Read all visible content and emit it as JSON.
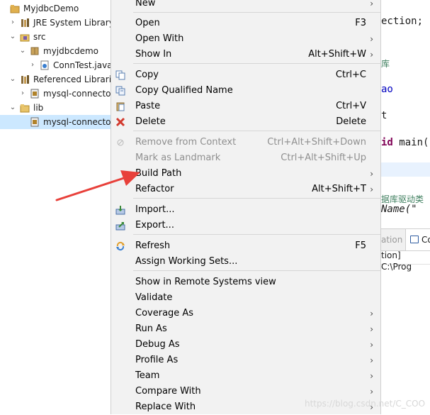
{
  "tree": {
    "items": [
      {
        "label": "MyjdbcDemo",
        "icon": "project-icon",
        "chevron": "",
        "selected": false
      },
      {
        "label": "JRE System Library [J",
        "icon": "library-icon",
        "chevron": "›",
        "selected": false
      },
      {
        "label": "src",
        "icon": "source-folder-icon",
        "chevron": "⌄",
        "selected": false
      },
      {
        "label": "myjdbcdemo",
        "icon": "package-icon",
        "chevron": "⌄",
        "selected": false
      },
      {
        "label": "ConnTest.java",
        "icon": "java-file-icon",
        "chevron": "›",
        "selected": false
      },
      {
        "label": "Referenced Libraries",
        "icon": "library-icon",
        "chevron": "⌄",
        "selected": false
      },
      {
        "label": "mysql-connector-",
        "icon": "jar-icon",
        "chevron": "›",
        "selected": false
      },
      {
        "label": "lib",
        "icon": "folder-icon",
        "chevron": "⌄",
        "selected": false
      },
      {
        "label": "mysql-connector-",
        "icon": "jar-icon",
        "chevron": "",
        "selected": true
      }
    ]
  },
  "editor": {
    "line1": "ection;",
    "line2_cmt": "库",
    "line3": "ao",
    "line4": "t",
    "line5_kw": "id",
    "line5_rest": " main(",
    "line6_cmt": "据库驱动类",
    "line7": "Name(\"",
    "tab_partial": "ation",
    "tab_console": "Co",
    "console_text": "tion] C:\\Prog"
  },
  "menu": {
    "items": [
      {
        "label": "New",
        "shortcut": "",
        "submenu": true,
        "disabled": false,
        "icon": ""
      },
      {
        "sep": true
      },
      {
        "label": "Open",
        "shortcut": "F3",
        "submenu": false,
        "disabled": false,
        "icon": ""
      },
      {
        "label": "Open With",
        "shortcut": "",
        "submenu": true,
        "disabled": false,
        "icon": ""
      },
      {
        "label": "Show In",
        "shortcut": "Alt+Shift+W",
        "submenu": true,
        "disabled": false,
        "icon": ""
      },
      {
        "sep": true
      },
      {
        "label": "Copy",
        "shortcut": "Ctrl+C",
        "submenu": false,
        "disabled": false,
        "icon": "copy-icon"
      },
      {
        "label": "Copy Qualified Name",
        "shortcut": "",
        "submenu": false,
        "disabled": false,
        "icon": "copy-qualified-icon"
      },
      {
        "label": "Paste",
        "shortcut": "Ctrl+V",
        "submenu": false,
        "disabled": false,
        "icon": "paste-icon"
      },
      {
        "label": "Delete",
        "shortcut": "Delete",
        "submenu": false,
        "disabled": false,
        "icon": "delete-icon"
      },
      {
        "sep": true
      },
      {
        "label": "Remove from Context",
        "shortcut": "Ctrl+Alt+Shift+Down",
        "submenu": false,
        "disabled": true,
        "icon": "remove-context-icon"
      },
      {
        "label": "Mark as Landmark",
        "shortcut": "Ctrl+Alt+Shift+Up",
        "submenu": false,
        "disabled": true,
        "icon": ""
      },
      {
        "label": "Build Path",
        "shortcut": "",
        "submenu": true,
        "disabled": false,
        "icon": ""
      },
      {
        "label": "Refactor",
        "shortcut": "Alt+Shift+T",
        "submenu": true,
        "disabled": false,
        "icon": ""
      },
      {
        "sep": true
      },
      {
        "label": "Import...",
        "shortcut": "",
        "submenu": false,
        "disabled": false,
        "icon": "import-icon"
      },
      {
        "label": "Export...",
        "shortcut": "",
        "submenu": false,
        "disabled": false,
        "icon": "export-icon"
      },
      {
        "sep": true
      },
      {
        "label": "Refresh",
        "shortcut": "F5",
        "submenu": false,
        "disabled": false,
        "icon": "refresh-icon"
      },
      {
        "label": "Assign Working Sets...",
        "shortcut": "",
        "submenu": false,
        "disabled": false,
        "icon": ""
      },
      {
        "sep": true
      },
      {
        "label": "Show in Remote Systems view",
        "shortcut": "",
        "submenu": false,
        "disabled": false,
        "icon": ""
      },
      {
        "label": "Validate",
        "shortcut": "",
        "submenu": false,
        "disabled": false,
        "icon": ""
      },
      {
        "label": "Coverage As",
        "shortcut": "",
        "submenu": true,
        "disabled": false,
        "icon": ""
      },
      {
        "label": "Run As",
        "shortcut": "",
        "submenu": true,
        "disabled": false,
        "icon": ""
      },
      {
        "label": "Debug As",
        "shortcut": "",
        "submenu": true,
        "disabled": false,
        "icon": ""
      },
      {
        "label": "Profile As",
        "shortcut": "",
        "submenu": true,
        "disabled": false,
        "icon": ""
      },
      {
        "label": "Team",
        "shortcut": "",
        "submenu": true,
        "disabled": false,
        "icon": ""
      },
      {
        "label": "Compare With",
        "shortcut": "",
        "submenu": true,
        "disabled": false,
        "icon": ""
      },
      {
        "label": "Replace With",
        "shortcut": "",
        "submenu": true,
        "disabled": false,
        "icon": ""
      }
    ],
    "submenu_arrow": "›"
  },
  "watermark": "https://blog.csdn.net/C_COO",
  "colors": {
    "selection": "#cce8ff",
    "menu_bg": "#f2f2f2",
    "disabled_text": "#8f8f8f",
    "arrow": "#e8403a",
    "keyword": "#7f0055",
    "comment": "#3f7f5f"
  }
}
